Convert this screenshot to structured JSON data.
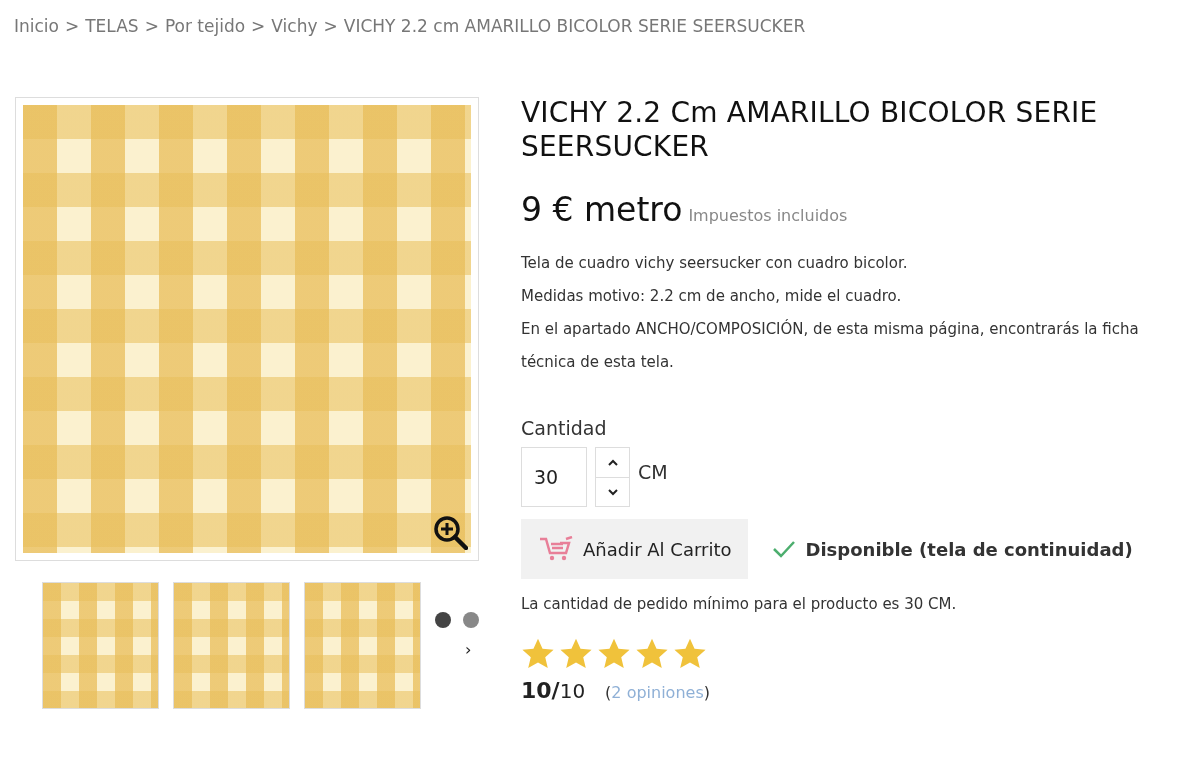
{
  "breadcrumb": [
    {
      "label": "Inicio"
    },
    {
      "label": "TELAS"
    },
    {
      "label": "Por tejido"
    },
    {
      "label": "Vichy"
    },
    {
      "label": "VICHY 2.2 cm AMARILLO BICOLOR SERIE SEERSUCKER"
    }
  ],
  "breadcrumb_separator": ">",
  "gallery": {
    "thumbnails": [
      {
        "selected": false
      },
      {
        "selected": false
      },
      {
        "selected": false
      }
    ],
    "dots": [
      {
        "selected": true
      },
      {
        "selected": false
      }
    ],
    "next_arrow": "›"
  },
  "product": {
    "title": "VICHY 2.2 Cm AMARILLO BICOLOR SERIE SEERSUCKER",
    "price": "9 € metro",
    "tax_note": "Impuestos incluidos",
    "description": [
      "Tela de cuadro vichy seersucker con cuadro bicolor.",
      "Medidas motivo: 2.2 cm de ancho, mide el cuadro.",
      "En el apartado ANCHO/COMPOSICIÓN, de esta misma página, encontrarás la ficha técnica de esta tela."
    ],
    "quantity_label": "Cantidad",
    "quantity": "30",
    "unit": "CM",
    "add_to_cart": "Añadir Al Carrito",
    "availability": "Disponible (tela de continuidad)",
    "minimum_note": "La cantidad de pedido mínimo para el producto es 30 CM.",
    "stars": 5,
    "score": "**10/**10",
    "reviews_open": "(",
    "reviews_link": "2 opiniones",
    "reviews_close": ")"
  }
}
